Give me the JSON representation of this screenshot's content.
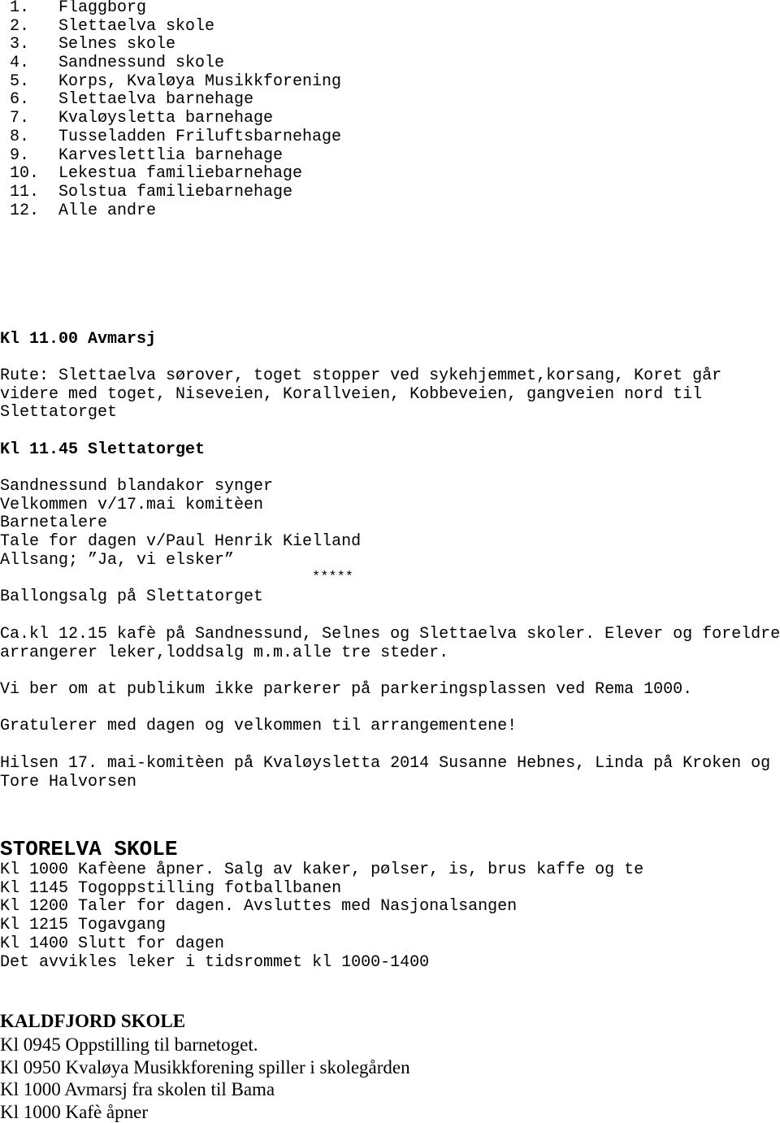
{
  "participants_list": [
    {
      "num": "1.",
      "label": "Flaggborg"
    },
    {
      "num": "2.",
      "label": "Slettaelva skole"
    },
    {
      "num": "3.",
      "label": "Selnes skole"
    },
    {
      "num": "4.",
      "label": "Sandnessund skole"
    },
    {
      "num": "5.",
      "label": "Korps, Kvaløya Musikkforening"
    },
    {
      "num": "6.",
      "label": "Slettaelva barnehage"
    },
    {
      "num": "7.",
      "label": "Kvaløysletta barnehage"
    },
    {
      "num": "8.",
      "label": "Tusseladden Friluftsbarnehage"
    },
    {
      "num": "9.",
      "label": "Karveslettlia barnehage"
    },
    {
      "num": "10.",
      "label": "Lekestua familiebarnehage"
    },
    {
      "num": "11.",
      "label": "Solstua familiebarnehage"
    },
    {
      "num": "12.",
      "label": "Alle andre"
    }
  ],
  "avmarsj": {
    "heading": "Kl 11.00 Avmarsj",
    "route_lines": [
      "Rute: Slettaelva sørover, toget stopper ved sykehjemmet,korsang, Koret går",
      "videre med toget, Niseveien, Korallveien, Kobbeveien, gangveien nord til",
      "Slettatorget"
    ]
  },
  "slettatorget": {
    "heading": "Kl 11.45 Slettatorget",
    "program": [
      "Sandnessund blandakor synger",
      "Velkommen v/17.mai komitèen",
      "Barnetalere",
      "Tale for dagen v/Paul Henrik Kielland",
      "Allsang; ”Ja, vi elsker”"
    ],
    "separator": "*****",
    "balloon": "Ballongsalg på Slettatorget"
  },
  "cafe": {
    "lines": [
      "Ca.kl 12.15 kafè på Sandnessund, Selnes og Slettaelva skoler. Elever og foreldre",
      "arrangerer leker,loddsalg m.m.alle tre steder."
    ]
  },
  "parking_note": "Vi ber om at publikum ikke parkerer på parkeringsplassen ved Rema 1000.",
  "congrats": "Gratulerer med dagen og velkommen til arrangementene!",
  "greeting": {
    "lines": [
      "Hilsen 17. mai-komitèen på Kvaløysletta 2014 Susanne Hebnes, Linda på Kroken og",
      "Tore Halvorsen"
    ]
  },
  "storelva": {
    "heading": "STORELVA SKOLE",
    "lines": [
      "Kl 1000 Kafèene åpner. Salg av kaker, pølser, is, brus kaffe og te",
      "Kl 1145 Togoppstilling fotballbanen",
      "Kl 1200 Taler for dagen. Avsluttes med Nasjonalsangen",
      "Kl 1215 Togavgang",
      "Kl 1400 Slutt for dagen",
      "Det avvikles leker i tidsrommet kl 1000-1400"
    ]
  },
  "kaldfjord": {
    "heading": "KALDFJORD SKOLE",
    "lines": [
      "Kl 0945 Oppstilling til barnetoget.",
      "Kl 0950 Kvaløya Musikkforening spiller i skolegården",
      "Kl 1000 Avmarsj fra skolen til Bama",
      "Kl 1000 Kafè åpner"
    ]
  }
}
